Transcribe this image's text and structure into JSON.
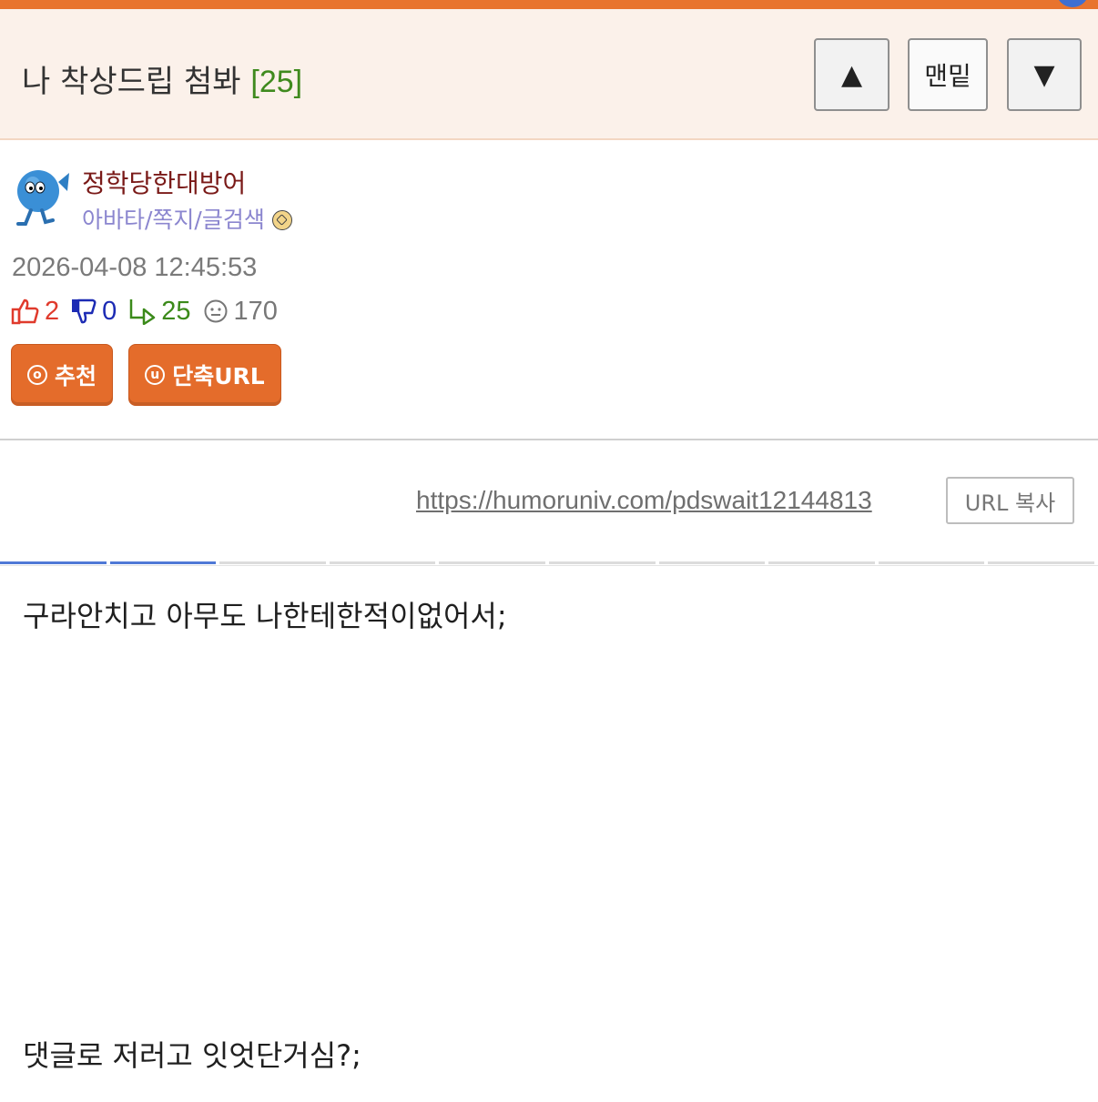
{
  "header": {
    "title": "나 착상드립 첨봐",
    "count": "[25]",
    "buttons": {
      "up": "▲",
      "bottom": "맨밑",
      "down": "▼"
    }
  },
  "author": {
    "nickname": "정학당한대방어",
    "links": "아바타/쪽지/글검색",
    "avatar_icon": "blue-fish-avatar"
  },
  "post": {
    "date": "2026-04-08 12:45:53",
    "stats": {
      "likes": "2",
      "dislikes": "0",
      "replies": "25",
      "views": "170"
    },
    "actions": {
      "recommend": "추천",
      "short_url": "단축URL"
    },
    "url": "https://humoruniv.com/pdswait12144813",
    "copy_label": "URL 복사",
    "body": [
      "구라안치고 아무도 나한테한적이없어서;",
      "댓글로 저러고 잇엇단거심?;"
    ]
  },
  "colors": {
    "accent": "#e8742e",
    "header_bg": "#fbf1ea",
    "nick": "#7a1a18",
    "like": "#e03a2c",
    "dislike": "#1c2bb4",
    "reply": "#3b8a1a"
  }
}
